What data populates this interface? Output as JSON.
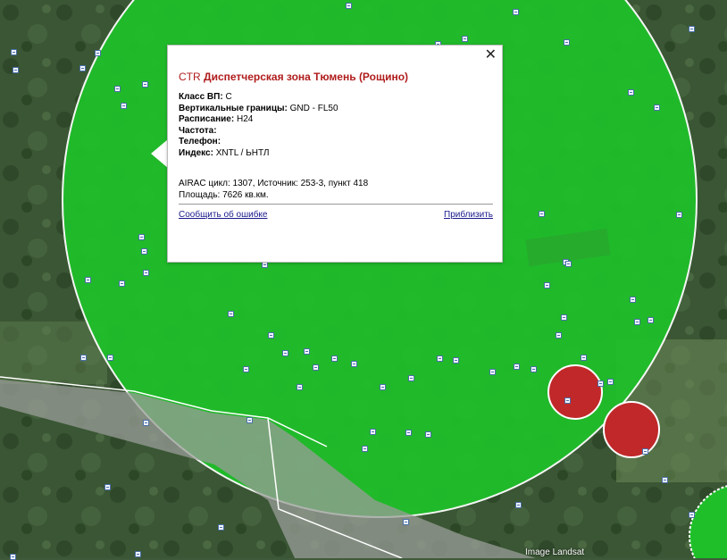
{
  "map": {
    "colors": {
      "terrain_dark": "#2f4a2c",
      "terrain_light": "#5c7a52",
      "ctr_fill": "#1fbf2a",
      "ctr_edge": "#ffffff",
      "restricted_fill": "#c0282a",
      "city_gray": "#8d8f8d"
    },
    "attribution": "Image Landsat"
  },
  "popup": {
    "close_symbol": "✕",
    "zone_type": "CTR",
    "zone_name": "Диспетчерская зона Тюмень (Рощино)",
    "fields": [
      {
        "label": "Класс ВП:",
        "value": "C"
      },
      {
        "label": "Вертикальные границы:",
        "value": "GND - FL50"
      },
      {
        "label": "Расписание:",
        "value": "H24"
      },
      {
        "label": "Частота:",
        "value": ""
      },
      {
        "label": "Телефон:",
        "value": ""
      },
      {
        "label": "Индекс:",
        "value": "XNTL / ЬНТЛ"
      }
    ],
    "airac": "AIRAC цикл: 1307, Источник: 253-3, пункт 418",
    "area": "Площадь: 7626 кв.км.",
    "report_link": "Сообщить об ошибке",
    "zoom_link": "Приблизить"
  }
}
